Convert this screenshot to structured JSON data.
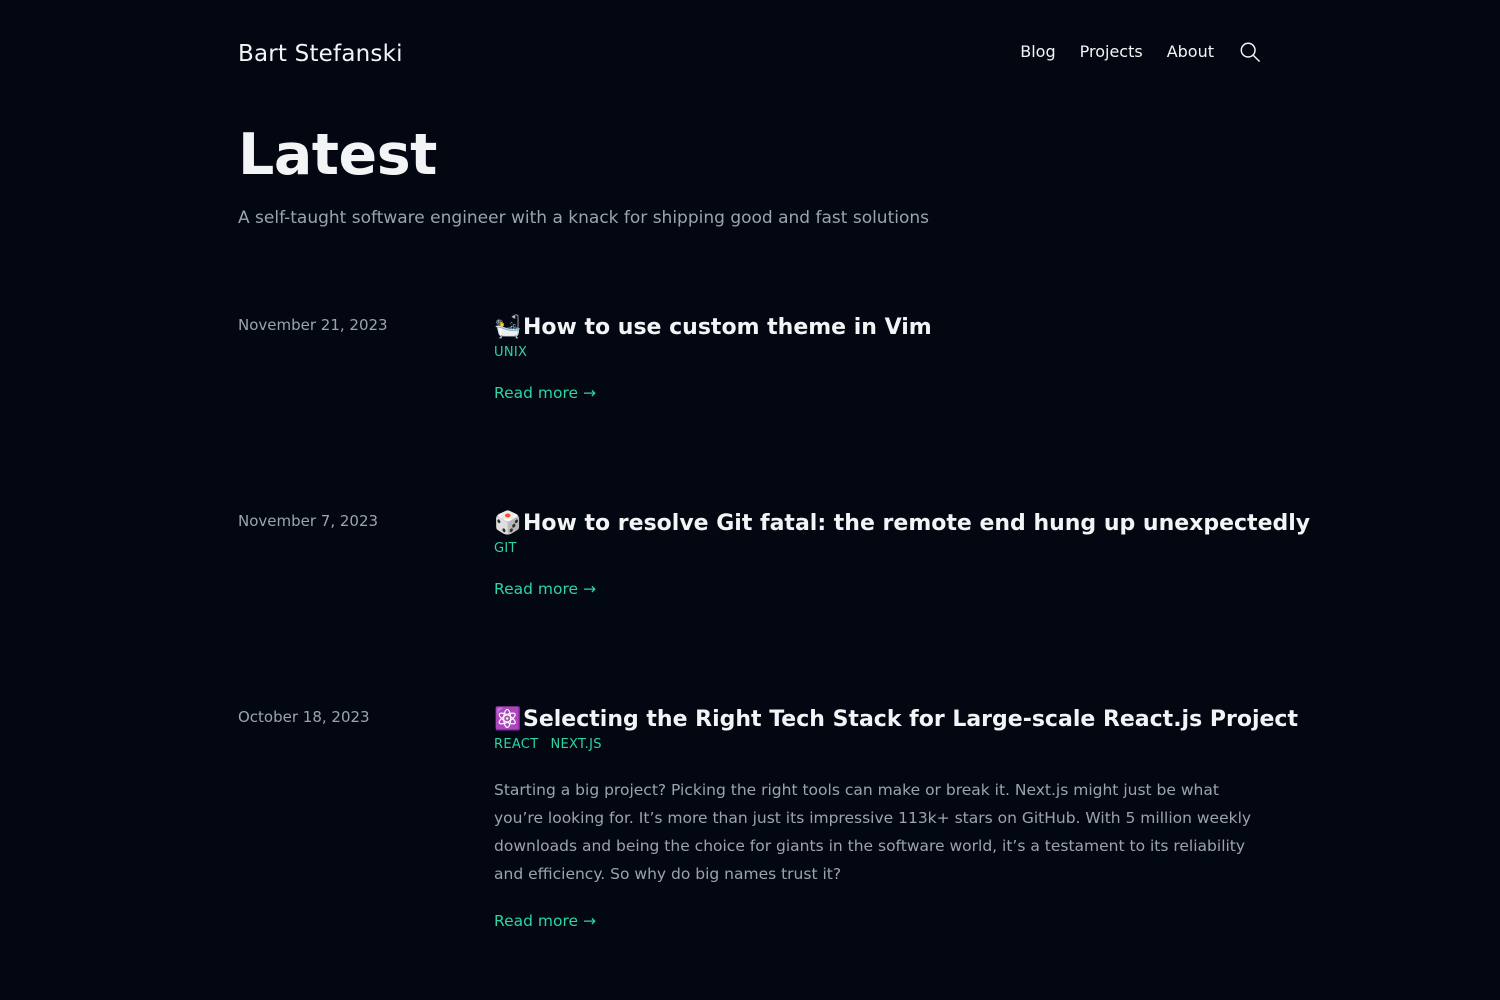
{
  "site": {
    "title": "Bart Stefanski"
  },
  "nav": {
    "items": [
      "Blog",
      "Projects",
      "About"
    ],
    "search_icon": "search-icon"
  },
  "hero": {
    "title": "Latest",
    "subtitle": "A self-taught software engineer with a knack for shipping good and fast solutions"
  },
  "posts": [
    {
      "date": "November 21, 2023",
      "emoji": "🛀",
      "title": "How to use custom theme in Vim",
      "tags": [
        "UNIX"
      ],
      "excerpt": "",
      "read_more": "Read more →"
    },
    {
      "date": "November 7, 2023",
      "emoji": "🎲",
      "title": "How to resolve Git fatal: the remote end hung up unexpectedly",
      "tags": [
        "GIT"
      ],
      "excerpt": "",
      "read_more": "Read more →"
    },
    {
      "date": "October 18, 2023",
      "emoji": "⚛️",
      "title": "Selecting the Right Tech Stack for Large-scale React.js Project",
      "tags": [
        "REACT",
        "NEXT.JS"
      ],
      "excerpt": "Starting a big project? Picking the right tools can make or break it. Next.js might just be what you’re looking for. It’s more than just its impressive 113k+ stars on GitHub. With 5 million weekly downloads and being the choice for giants in the software world, it’s a testament to its reliability and efficiency. So why do big names trust it?",
      "read_more": "Read more →"
    }
  ],
  "colors": {
    "background": "#030712",
    "text": "#f3f4f6",
    "muted": "#9ca3af",
    "accent": "#2dd4a4"
  }
}
